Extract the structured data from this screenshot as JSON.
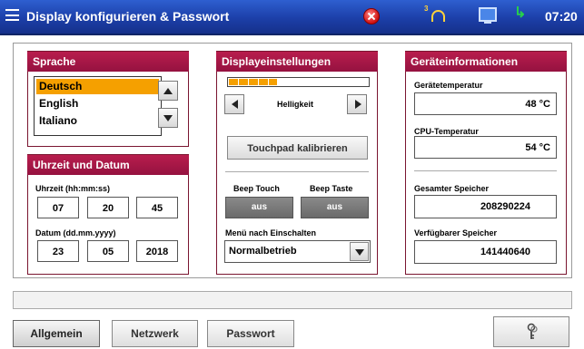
{
  "titlebar": {
    "title": "Display konfigurieren & Passwort",
    "user_level": "3",
    "time": "07:20"
  },
  "sprache": {
    "header": "Sprache",
    "items": [
      {
        "label": "Deutsch",
        "selected": true
      },
      {
        "label": "English",
        "selected": false
      },
      {
        "label": "Italiano",
        "selected": false
      }
    ]
  },
  "uhrzeit": {
    "header": "Uhrzeit und Datum",
    "time_label": "Uhrzeit (hh:mm:ss)",
    "hours": "07",
    "minutes": "20",
    "seconds": "45",
    "date_label": "Datum (dd.mm.yyyy)",
    "day": "23",
    "month": "05",
    "year": "2018"
  },
  "display": {
    "header": "Displayeinstellungen",
    "brightness_label": "Helligkeit",
    "brightness_level": 0.4,
    "calibrate_label": "Touchpad kalibrieren",
    "beep_touch_label": "Beep Touch",
    "beep_touch_value": "aus",
    "beep_taste_label": "Beep Taste",
    "beep_taste_value": "aus",
    "menu_label": "Menü nach Einschalten",
    "menu_value": "Normalbetrieb"
  },
  "geraet": {
    "header": "Geräteinformationen",
    "temp_label": "Gerätetemperatur",
    "temp_value": "48  °C",
    "cpu_label": "CPU-Temperatur",
    "cpu_value": "54  °C",
    "total_mem_label": "Gesamter Speicher",
    "total_mem_value": "208290224",
    "free_mem_label": "Verfügbarer Speicher",
    "free_mem_value": "141440640"
  },
  "tabs": [
    {
      "label": "Allgemein",
      "active": true
    },
    {
      "label": "Netzwerk",
      "active": false
    },
    {
      "label": "Passwort",
      "active": false
    }
  ],
  "colors": {
    "titlebar": "#1c3fa8",
    "panel_header": "#a8174a",
    "selection": "#f5a000"
  },
  "icons": [
    "menu-icon",
    "error-icon",
    "user-level-icon",
    "monitor-icon",
    "connection-arrow-icon",
    "key-icon"
  ]
}
